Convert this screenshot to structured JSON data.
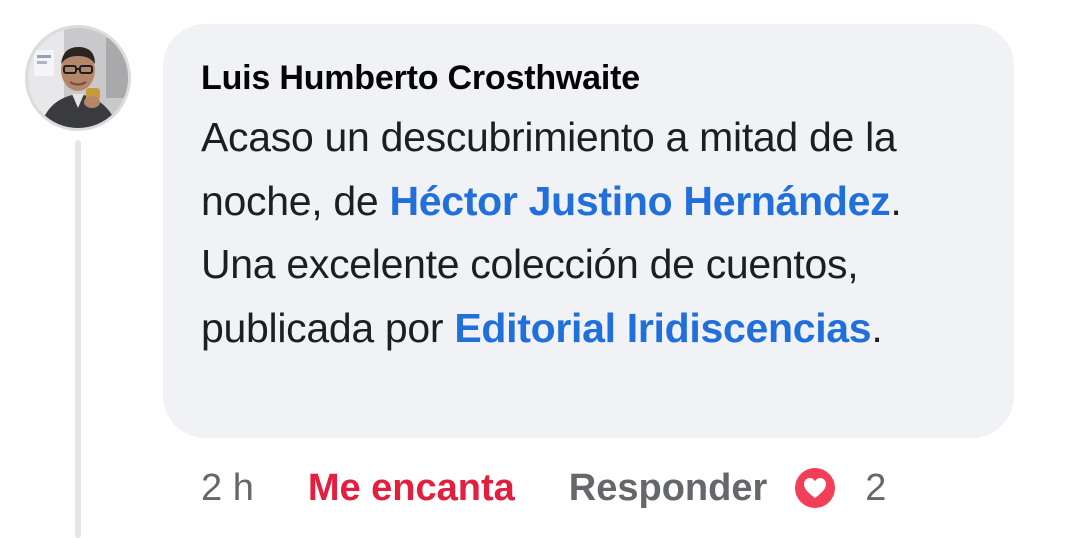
{
  "comment": {
    "author": "Luis Humberto Crosthwaite",
    "body": [
      {
        "type": "text",
        "text": "Acaso un descubrimiento a mitad de la noche, de "
      },
      {
        "type": "mention",
        "text": "Héctor Justino Hernández"
      },
      {
        "type": "text",
        "text": ". Una excelente colección de cuentos, publicada por "
      },
      {
        "type": "mention",
        "text": "Editorial Iridiscencias"
      },
      {
        "type": "text",
        "text": "."
      }
    ],
    "time": "2 h",
    "love_label": "Me encanta",
    "reply_label": "Responder",
    "reaction_icon": "heart-icon",
    "reaction_count": "2"
  },
  "colors": {
    "bubble": "#f0f2f5",
    "mention": "#216fdb",
    "love": "#e41e3f",
    "muted": "#65676b",
    "heart": "#f33e58"
  }
}
